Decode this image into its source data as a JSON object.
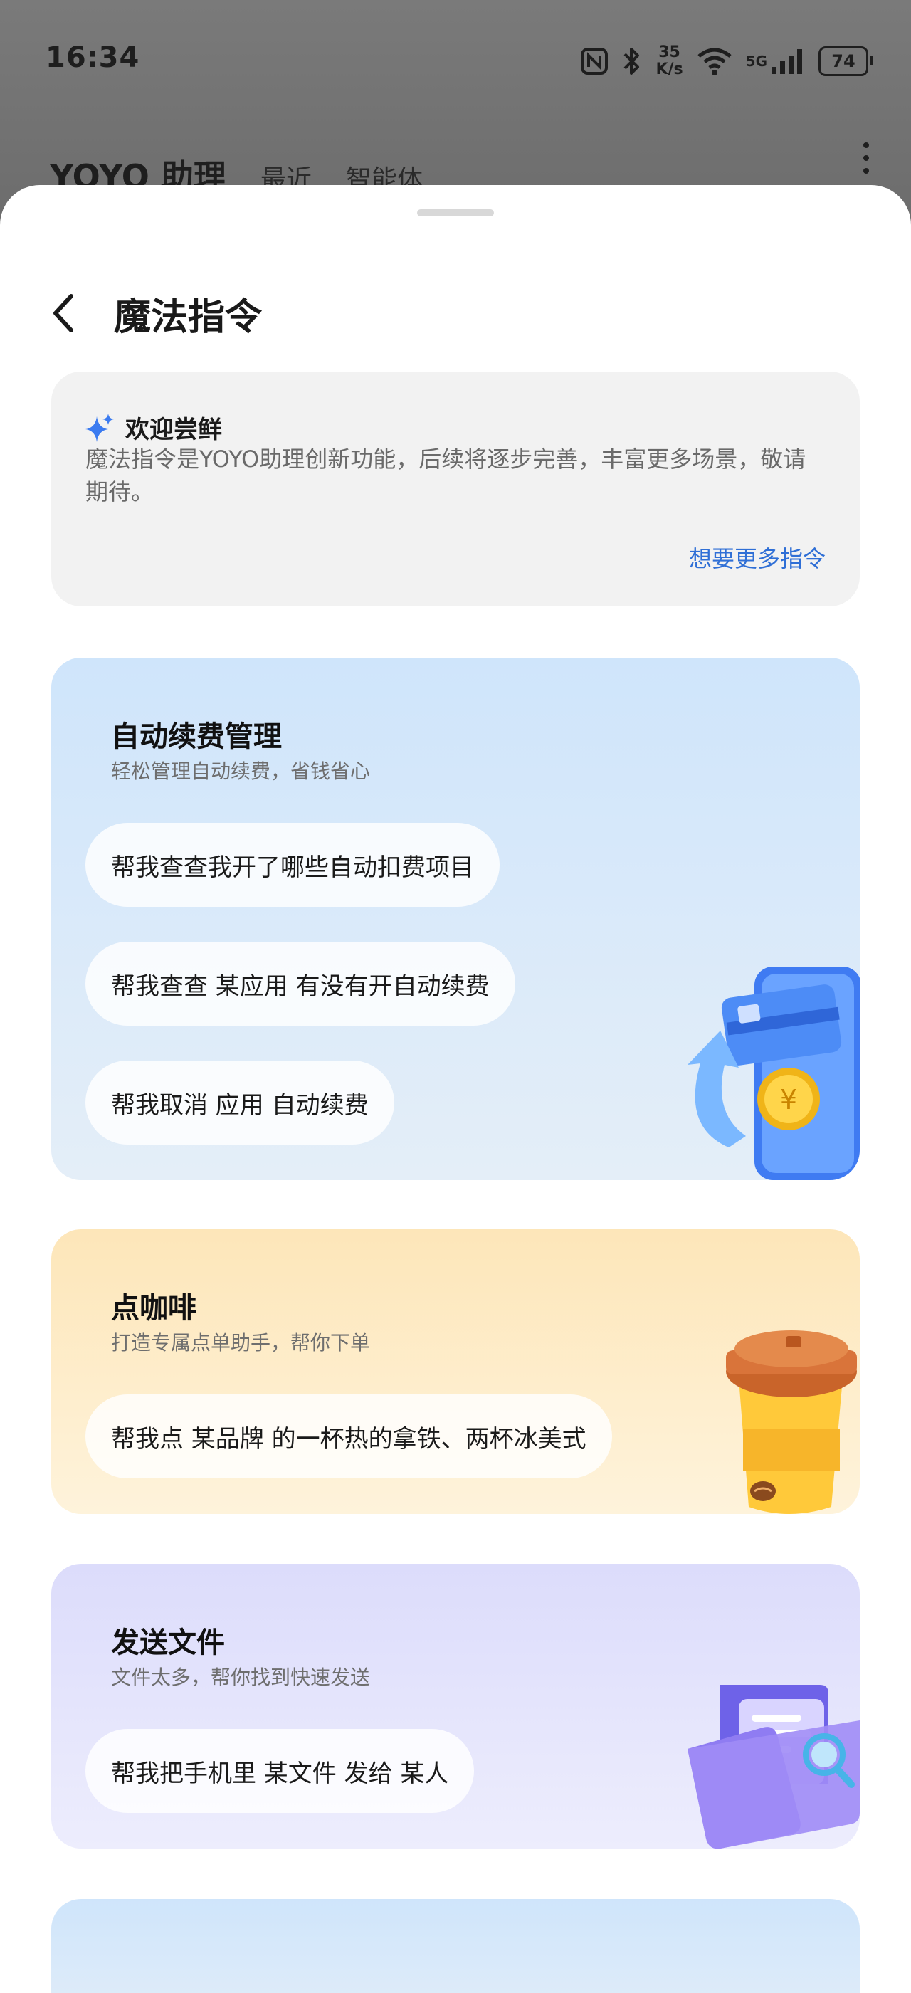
{
  "status_bar": {
    "time": "16:34",
    "net_speed_value": "35",
    "net_speed_unit": "K/s",
    "signal_label": "5G",
    "battery": "74"
  },
  "background_app": {
    "title": "YOYO 助理",
    "tabs": [
      "最近",
      "智能体"
    ]
  },
  "sheet": {
    "title": "魔法指令",
    "welcome": {
      "title": "欢迎尝鲜",
      "description": "魔法指令是YOYO助理创新功能，后续将逐步完善，丰富更多场景，敬请期待。",
      "link": "想要更多指令"
    },
    "cards": [
      {
        "title": "自动续费管理",
        "subtitle": "轻松管理自动续费，省钱省心",
        "commands": [
          "帮我查查我开了哪些自动扣费项目",
          "帮我查查 某应用 有没有开自动续费",
          "帮我取消 应用 自动续费"
        ]
      },
      {
        "title": "点咖啡",
        "subtitle": "打造专属点单助手，帮你下单",
        "commands": [
          "帮我点 某品牌 的一杯热的拿铁、两杯冰美式"
        ]
      },
      {
        "title": "发送文件",
        "subtitle": "文件太多，帮你找到快速发送",
        "commands": [
          "帮我把手机里 某文件 发给 某人"
        ]
      }
    ]
  },
  "colors": {
    "link": "#2f6fd6",
    "sparkle": "#3b7bf0"
  }
}
